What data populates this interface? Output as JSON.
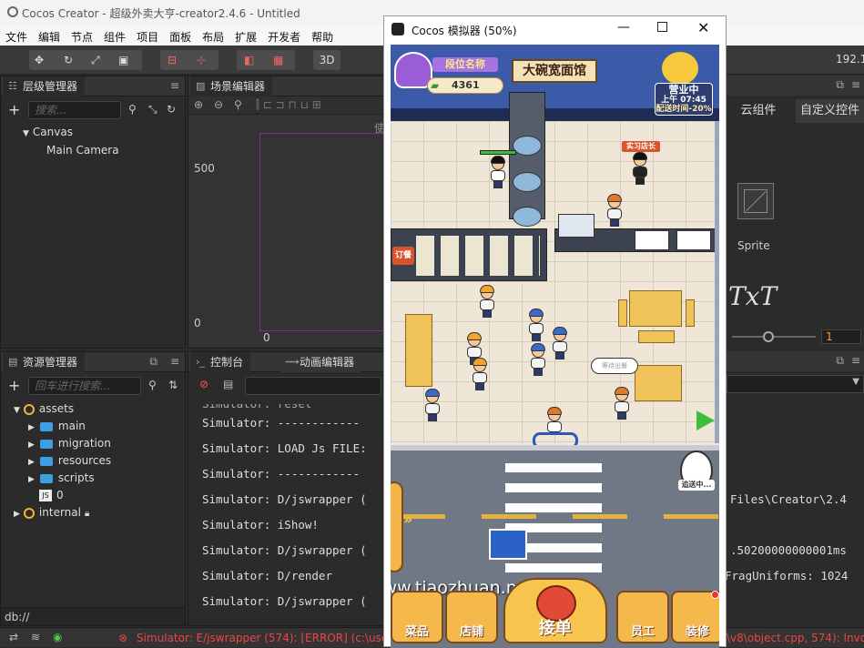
{
  "window": {
    "title": "Cocos Creator - 超级外卖大亨-creator2.4.6 - Untitled"
  },
  "menu": [
    "文件",
    "编辑",
    "节点",
    "组件",
    "项目",
    "面板",
    "布局",
    "扩展",
    "开发者",
    "帮助"
  ],
  "toolbar": {
    "mode_3d": "3D",
    "ip": "192.1"
  },
  "hierarchy": {
    "tab": "层级管理器",
    "search_placeholder": "搜索...",
    "nodes": [
      "Canvas",
      "Main Camera"
    ]
  },
  "scene": {
    "tab": "场景编辑器",
    "y_label_top": "500",
    "y_label_bottom": "0",
    "x_label": "0",
    "hint": "使"
  },
  "assets": {
    "tab": "资源管理器",
    "search_placeholder": "回车进行搜索...",
    "items": [
      "assets",
      "main",
      "migration",
      "resources",
      "scripts",
      "0",
      "internal"
    ],
    "js_badge": "JS",
    "path": "db://"
  },
  "console": {
    "tab": "控制台",
    "tab2": "动画编辑器",
    "lines": [
      "Simulator: ------------",
      "Simulator: LOAD Js FILE:",
      "Simulator: ------------",
      "Simulator: D/jswrapper (",
      "Simulator: iShow!",
      "Simulator: D/jswrapper (",
      "Simulator: D/render",
      "Simulator: D/jswrapper ("
    ],
    "right_fragments": [
      "Files\\Creator\\2.4",
      ".50200000000001ms",
      "FragUniforms: 1024"
    ]
  },
  "library": {
    "tab_cloud": "云组件",
    "tab_custom": "自定义控件",
    "sprite_label": "Sprite",
    "txt_label": "TxT",
    "slider_value": "1"
  },
  "simulator": {
    "title": "Cocos 模拟器 (50%)",
    "game": {
      "shop_name": "大碗宽面馆",
      "rank_label": "段位名称",
      "coins": "4361",
      "status": "营业中",
      "time": "上午 07:45",
      "delivery_bonus": "配送时间-20%",
      "intern_badge": "实习店长",
      "sign_order": "订餐",
      "bubble_text": "等待出餐",
      "courier_label": "追送中...",
      "watermark": "www.tiaozhuan.net",
      "buttons": [
        "菜品",
        "店铺",
        "接单",
        "员工",
        "装修"
      ]
    }
  },
  "statusbar": {
    "error": "Simulator: E/jswrapper (574): [ERROR] (c:\\users\\na",
    "error_tail": "\\v8\\object.cpp, 574): Invokin"
  }
}
